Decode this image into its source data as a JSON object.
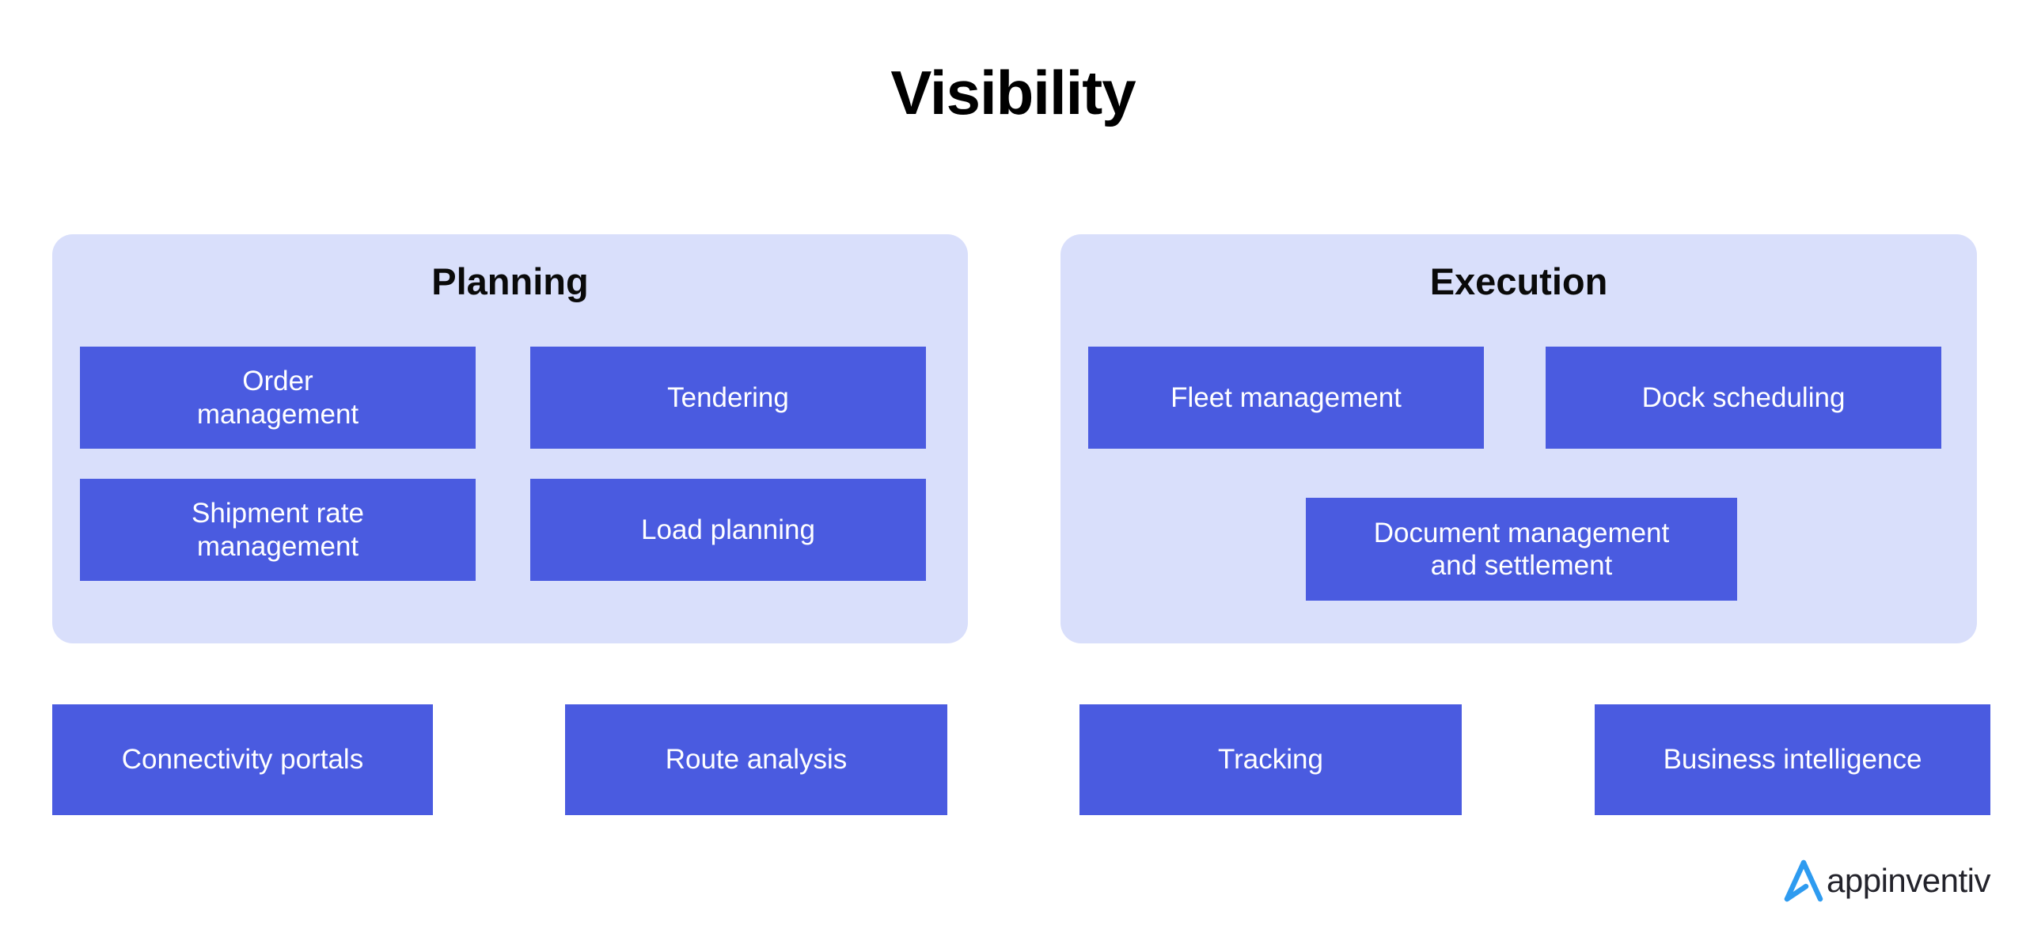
{
  "diagram": {
    "title": "Visibility",
    "colors": {
      "panel_background": "#d9dffb",
      "tile_background": "#4a5be0",
      "tile_text": "#ffffff",
      "title_text": "#000000",
      "page_background": "#ffffff",
      "logo_mark": "#2e9bf0",
      "logo_wordmark": "#23232b"
    },
    "groups": [
      {
        "id": "planning",
        "title": "Planning",
        "items": [
          {
            "label": "Order\nmanagement"
          },
          {
            "label": "Tendering"
          },
          {
            "label": "Shipment rate\nmanagement"
          },
          {
            "label": "Load planning"
          }
        ]
      },
      {
        "id": "execution",
        "title": "Execution",
        "items": [
          {
            "label": "Fleet management"
          },
          {
            "label": "Dock scheduling"
          },
          {
            "label": "Document management\nand settlement"
          }
        ]
      }
    ],
    "footer_items": [
      {
        "label": "Connectivity portals"
      },
      {
        "label": "Route analysis"
      },
      {
        "label": "Tracking"
      },
      {
        "label": "Business intelligence"
      }
    ],
    "brand": {
      "name": "appinventiv",
      "mark_icon": "appinventiv-a-chevron-icon"
    }
  }
}
